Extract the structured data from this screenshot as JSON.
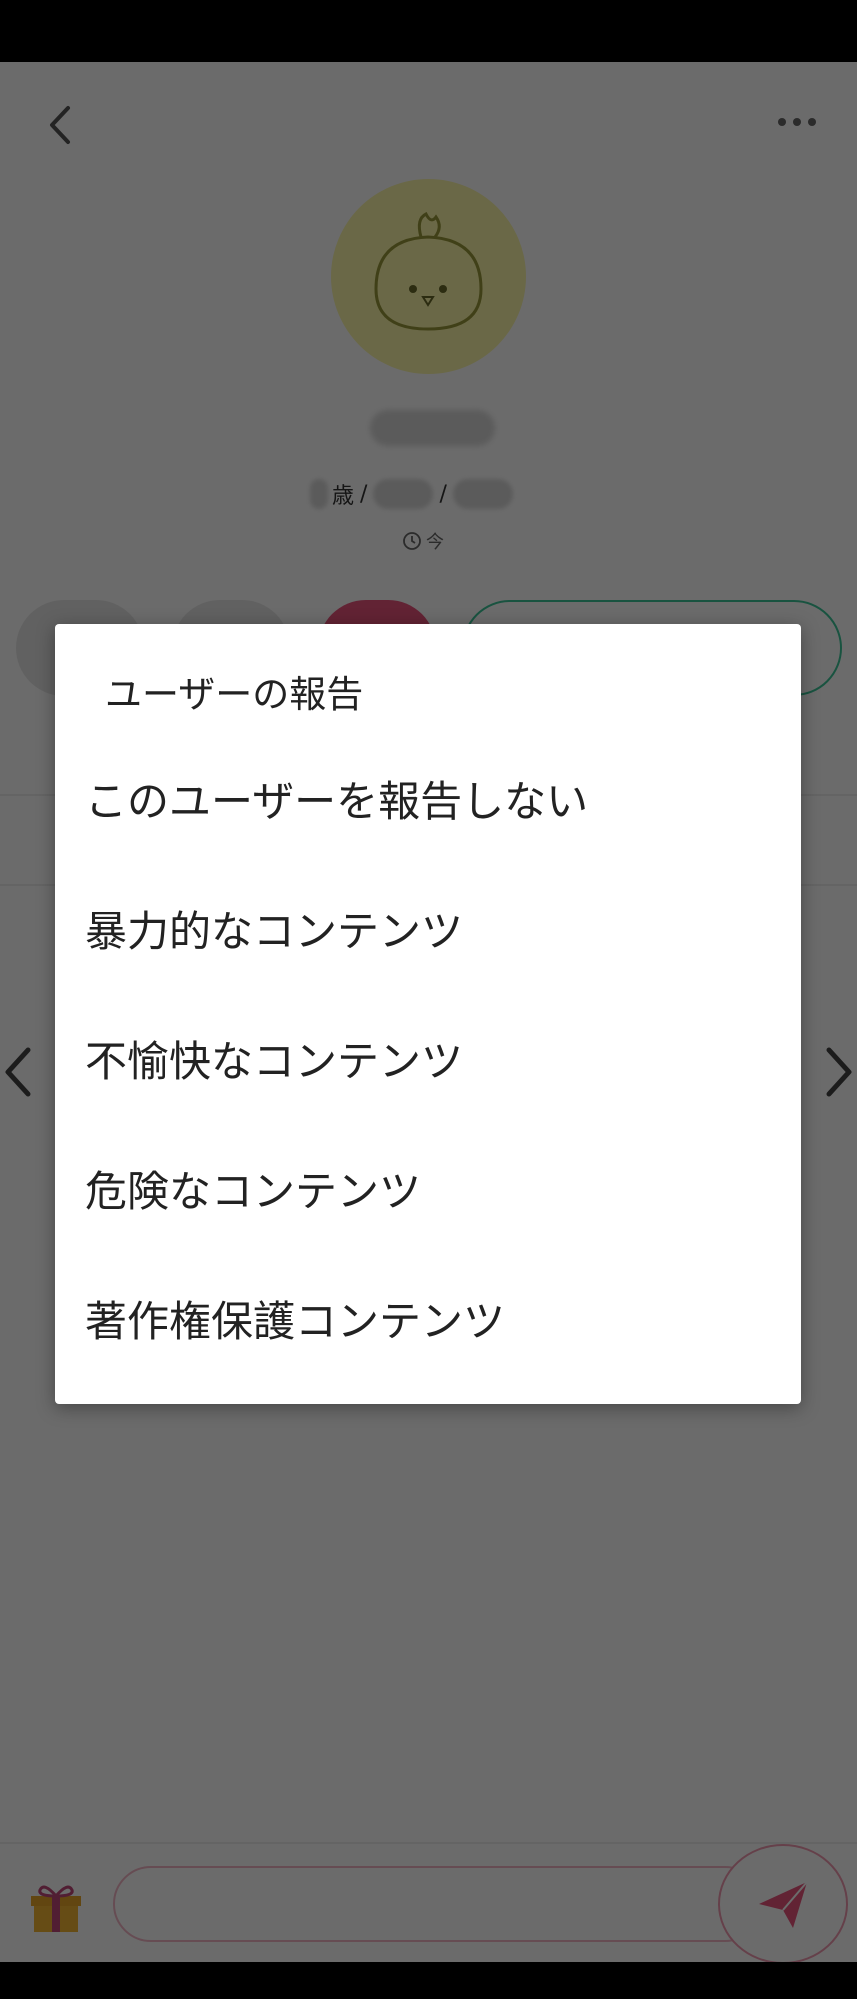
{
  "profile": {
    "age_suffix": "歳",
    "separator": "/",
    "online_status": "今"
  },
  "dialog": {
    "title": "ユーザーの報告",
    "options": [
      "このユーザーを報告しない",
      "暴力的なコンテンツ",
      "不愉快なコンテンツ",
      "危険なコンテンツ",
      "著作権保護コンテンツ"
    ]
  },
  "colors": {
    "overlay": "#000000",
    "avatar_bg": "#fdf7a9",
    "accent_pink": "#e9537d",
    "accent_green": "#3cc79a"
  },
  "icons": {
    "back": "chevron-left-icon",
    "more": "more-dots-icon",
    "clock": "clock-icon",
    "gift": "gift-icon",
    "send": "send-icon",
    "prev": "chevron-left-icon",
    "next": "chevron-right-icon"
  }
}
